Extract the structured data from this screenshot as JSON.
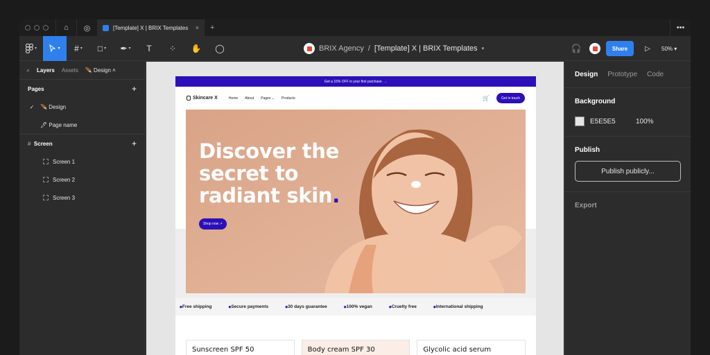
{
  "titlebar": {
    "home_icon": "home-icon",
    "globe_icon": "globe-icon",
    "tab_label": "[Template] X | BRIX Templates",
    "close": "×",
    "new_tab": "+",
    "more": "•••"
  },
  "toolbar": {
    "breadcrumb_team": "BRIX Agency",
    "breadcrumb_sep": "/",
    "breadcrumb_file": "[Template] X | BRIX Templates",
    "share_label": "Share",
    "zoom": "50%"
  },
  "left_panel": {
    "tabs": [
      "Layers",
      "Assets"
    ],
    "page_tab": "Design",
    "pages_header": "Pages",
    "pages": [
      "Design",
      "Page name"
    ],
    "screen_header": "Screen",
    "screens": [
      "Screen 1",
      "Screen 2",
      "Screen 3"
    ]
  },
  "canvas": {
    "background": "#E5E5E5",
    "promo": "Get a 15% OFF in your first purchase. →",
    "brand": "Skincare X",
    "nav": [
      "Home",
      "About",
      "Pages",
      "Products"
    ],
    "cta": "Get in touch",
    "hero_line1": "Discover the",
    "hero_line2": "secret to",
    "hero_line3": "radiant skin",
    "hero_dot": ".",
    "shop_label": "Shop now ↗",
    "features": [
      "Free shipping",
      "Secure payments",
      "30 days guarantee",
      "100% vegan",
      "Cruelty free",
      "International shipping"
    ],
    "products": [
      "Sunscreen SPF 50",
      "Body cream SPF 30",
      "Glycolic acid serum"
    ],
    "accent": "#2C0FB8"
  },
  "right_panel": {
    "tabs": [
      "Design",
      "Prototype",
      "Code"
    ],
    "background_title": "Background",
    "bg_hex": "E5E5E5",
    "bg_opacity": "100%",
    "publish_title": "Publish",
    "publish_button": "Publish publicly...",
    "export_title": "Export"
  }
}
